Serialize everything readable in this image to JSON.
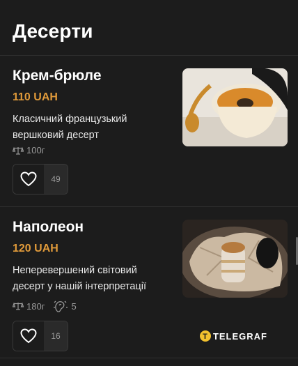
{
  "header": {
    "title": "Десерти"
  },
  "items": [
    {
      "name": "Крем-брюле",
      "price": "110 UAH",
      "description_line1": "Класичний французький",
      "description_line2": "вершковий десерт",
      "weight": "100г",
      "likes": "49",
      "weight_icon": "scale-icon",
      "like_icon": "heart-icon"
    },
    {
      "name": "Наполеон",
      "price": "120 UAH",
      "description_line1": "Неперевершений світовий",
      "description_line2": "десерт у нашій інтерпретації",
      "weight": "180г",
      "allergens": "5",
      "likes": "16",
      "weight_icon": "scale-icon",
      "allergen_icon": "allergen-icon",
      "like_icon": "heart-icon"
    }
  ],
  "watermark": {
    "text": "TELEGRAF",
    "logo_letter": "T"
  },
  "colors": {
    "background": "#1c1c1c",
    "price": "#e09a3a",
    "muted": "#9a9a9a",
    "logo": "#f2c12e"
  }
}
